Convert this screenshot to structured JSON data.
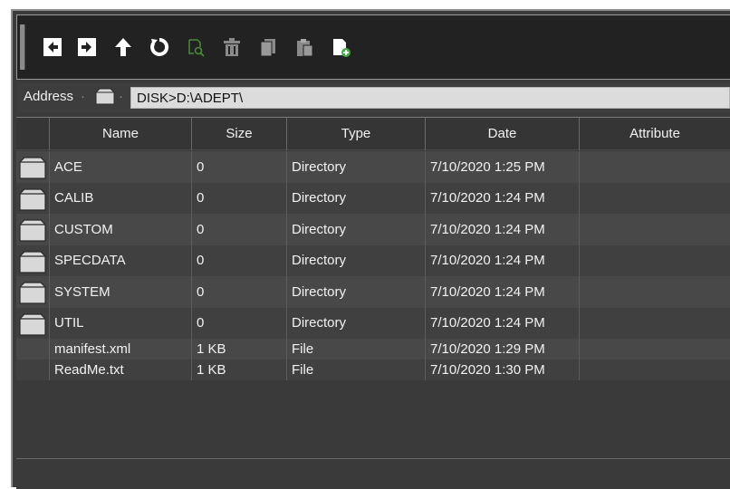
{
  "toolbar": {
    "buttons": [
      {
        "name": "back-button",
        "icon": "arrow-left-icon"
      },
      {
        "name": "forward-button",
        "icon": "arrow-right-icon"
      },
      {
        "name": "up-button",
        "icon": "arrow-up-icon"
      },
      {
        "name": "refresh-button",
        "icon": "refresh-icon"
      },
      {
        "name": "search-button",
        "icon": "search-file-icon"
      },
      {
        "name": "delete-button",
        "icon": "trash-icon"
      },
      {
        "name": "copy-button",
        "icon": "copy-icon"
      },
      {
        "name": "paste-button",
        "icon": "paste-icon"
      },
      {
        "name": "new-file-button",
        "icon": "new-file-icon"
      }
    ]
  },
  "address": {
    "label": "Address",
    "value": "DISK>D:\\ADEPT\\"
  },
  "columns": [
    "Name",
    "Size",
    "Type",
    "Date",
    "Attribute"
  ],
  "rows": [
    {
      "name": "ACE",
      "size": "0",
      "type": "Directory",
      "date": "7/10/2020 1:25 PM",
      "attribute": "",
      "folder": true
    },
    {
      "name": "CALIB",
      "size": "0",
      "type": "Directory",
      "date": "7/10/2020 1:24 PM",
      "attribute": "",
      "folder": true
    },
    {
      "name": "CUSTOM",
      "size": "0",
      "type": "Directory",
      "date": "7/10/2020 1:24 PM",
      "attribute": "",
      "folder": true
    },
    {
      "name": "SPECDATA",
      "size": "0",
      "type": "Directory",
      "date": "7/10/2020 1:24 PM",
      "attribute": "",
      "folder": true
    },
    {
      "name": "SYSTEM",
      "size": "0",
      "type": "Directory",
      "date": "7/10/2020 1:24 PM",
      "attribute": "",
      "folder": true
    },
    {
      "name": "UTIL",
      "size": "0",
      "type": "Directory",
      "date": "7/10/2020 1:24 PM",
      "attribute": "",
      "folder": true
    },
    {
      "name": "manifest.xml",
      "size": "1 KB",
      "type": "File",
      "date": "7/10/2020 1:29 PM",
      "attribute": "",
      "folder": false
    },
    {
      "name": "ReadMe.txt",
      "size": "1 KB",
      "type": "File",
      "date": "7/10/2020 1:30 PM",
      "attribute": "",
      "folder": false
    }
  ],
  "colors": {
    "toolbar_bg": "#222222",
    "panel_bg": "#3a3a3a",
    "row_odd": "#484848",
    "row_even": "#404040",
    "icon_white": "#ffffff",
    "icon_disabled": "#8a8a8a",
    "icon_search_green": "#4a8a3a",
    "icon_add_green": "#3fae3f"
  }
}
